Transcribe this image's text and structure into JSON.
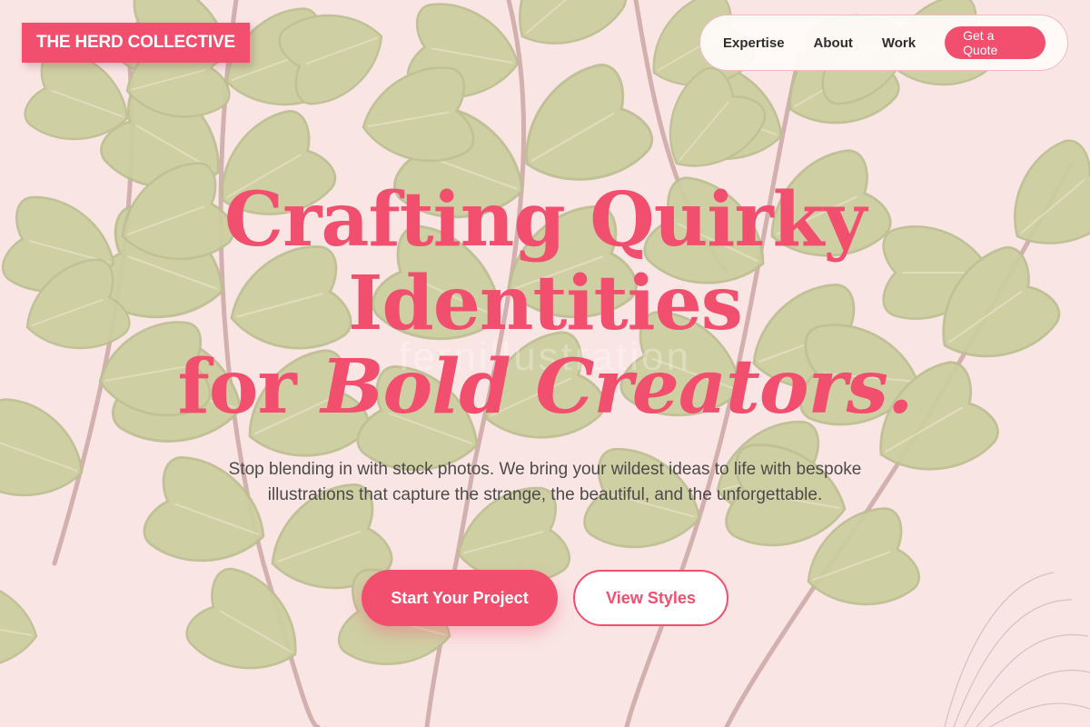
{
  "brand": {
    "logo_text": "THE HERD COLLECTIVE",
    "accent_color": "#f24e6d"
  },
  "nav": {
    "links": [
      {
        "label": "Expertise"
      },
      {
        "label": "About"
      },
      {
        "label": "Work"
      }
    ],
    "cta_label": "Get a Quote"
  },
  "hero": {
    "headline_line1": "Crafting Quirky",
    "headline_line2": "Identities",
    "headline_line3_prefix": "for",
    "headline_line3_italic": "Bold Creators.",
    "subcopy": "Stop blending in with stock photos. We bring your wildest ideas to life with bespoke illustrations that capture the strange, the beautiful, and the unforgettable.",
    "primary_button_label": "Start Your Project",
    "secondary_button_label": "View Styles"
  },
  "background": {
    "description": "fern-illustration-image",
    "watermark_text": "fernillustration"
  }
}
